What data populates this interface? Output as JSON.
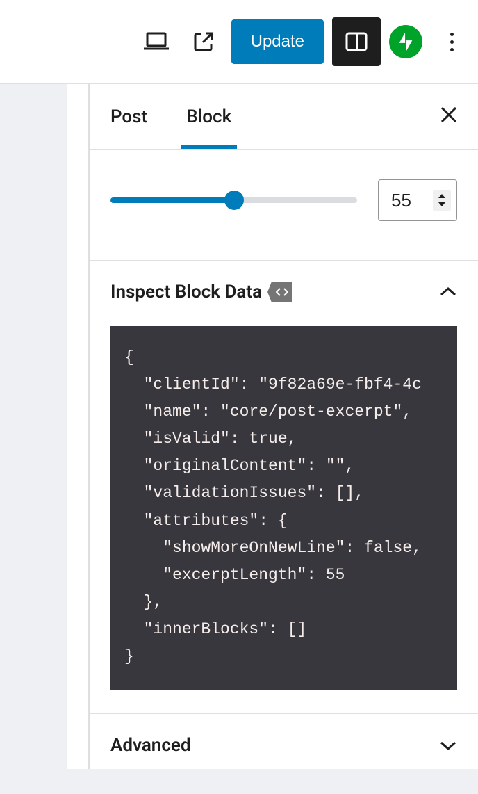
{
  "toolbar": {
    "update_label": "Update"
  },
  "tabs": {
    "post_label": "Post",
    "block_label": "Block",
    "active": "block"
  },
  "slider": {
    "value": 55,
    "min": 0,
    "max": 100,
    "percent": 50
  },
  "inspect": {
    "title": "Inspect Block Data",
    "expanded": true,
    "data": {
      "clientId": "9f82a69e-fbf4-4c",
      "name": "core/post-excerpt",
      "isValid": true,
      "originalContent": "",
      "validationIssues": [],
      "attributes": {
        "showMoreOnNewLine": false,
        "excerptLength": 55
      },
      "innerBlocks": []
    }
  },
  "advanced": {
    "title": "Advanced",
    "expanded": false
  }
}
